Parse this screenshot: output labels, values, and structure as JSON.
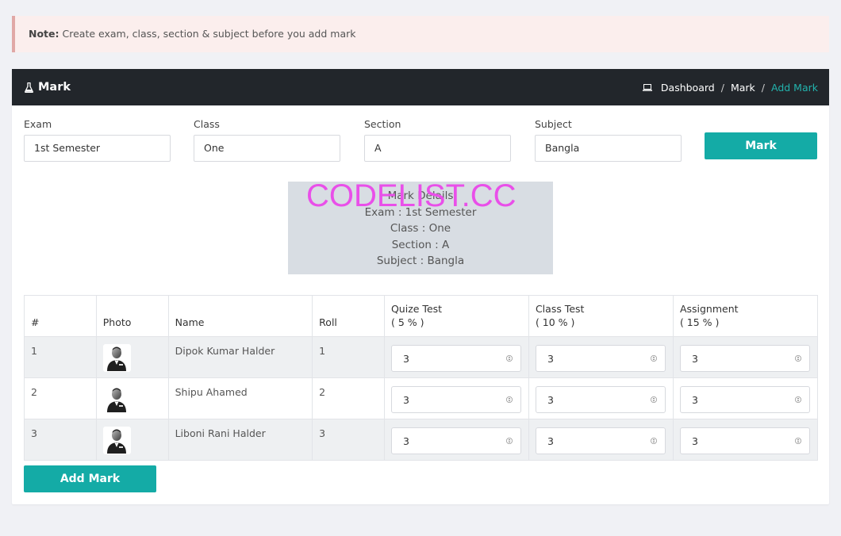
{
  "note": {
    "label": "Note:",
    "text": "Create exam, class, section & subject before you add mark"
  },
  "header": {
    "title": "Mark",
    "breadcrumb": [
      "Dashboard",
      "Mark",
      "Add Mark"
    ]
  },
  "filters": {
    "exam": {
      "label": "Exam",
      "value": "1st Semester"
    },
    "class": {
      "label": "Class",
      "value": "One"
    },
    "section": {
      "label": "Section",
      "value": "A"
    },
    "subject": {
      "label": "Subject",
      "value": "Bangla"
    },
    "button": "Mark"
  },
  "details": {
    "title": "Mark Delails",
    "exam": "Exam : 1st Semester",
    "class": "Class : One",
    "section": "Section : A",
    "subject": "Subject : Bangla"
  },
  "watermark": "CODELIST.CC",
  "table": {
    "headers": {
      "num": "#",
      "photo": "Photo",
      "name": "Name",
      "roll": "Roll",
      "quiz": "Quize Test",
      "quiz_pct": "( 5 % )",
      "class_test": "Class Test",
      "class_test_pct": "( 10 % )",
      "assignment": "Assignment",
      "assignment_pct": "( 15 % )"
    },
    "rows": [
      {
        "num": "1",
        "name": "Dipok Kumar Halder",
        "roll": "1",
        "quiz": "3",
        "class_test": "3",
        "assignment": "3"
      },
      {
        "num": "2",
        "name": "Shipu Ahamed",
        "roll": "2",
        "quiz": "3",
        "class_test": "3",
        "assignment": "3"
      },
      {
        "num": "3",
        "name": "Liboni Rani Halder",
        "roll": "3",
        "quiz": "3",
        "class_test": "3",
        "assignment": "3"
      }
    ]
  },
  "add_button": "Add Mark",
  "colors": {
    "accent": "#14aba6",
    "header_bg": "#22262b",
    "breadcrumb_active": "#22b3ad",
    "note_bg": "#fbeeed"
  }
}
